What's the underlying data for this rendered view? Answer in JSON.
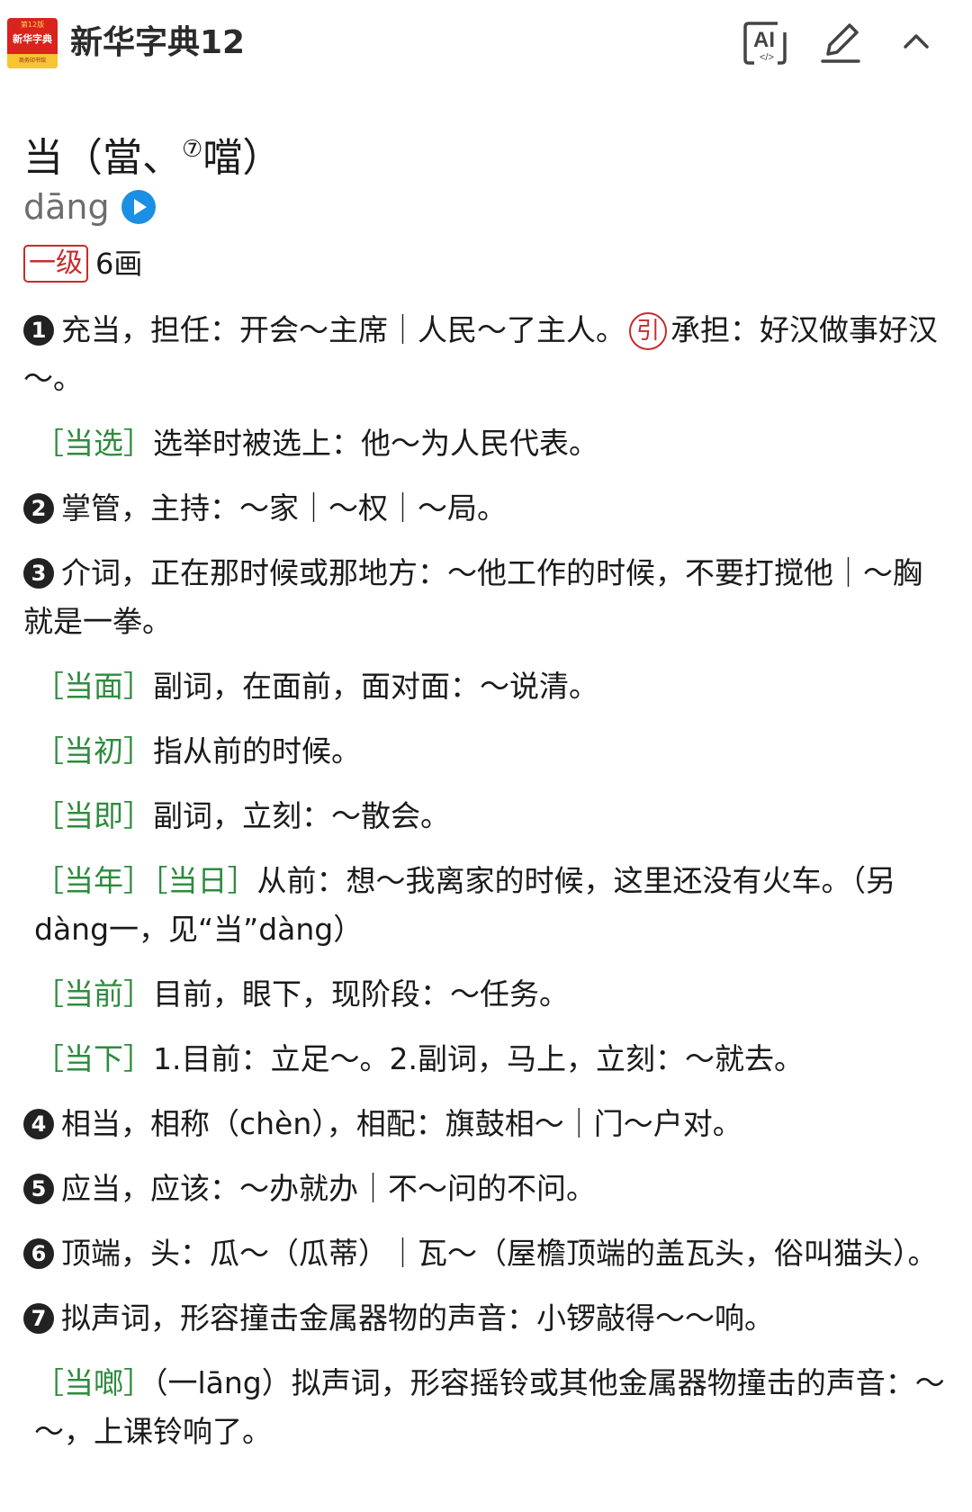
{
  "header": {
    "logo_top": "第12版",
    "logo_mid": "新华字典",
    "logo_bottom": "商务印书馆",
    "title": "新华字典12",
    "ai_label": "AI",
    "ai_sub": "</>"
  },
  "entry": {
    "headword": "当（當、",
    "variant_mark": "⑦",
    "variant_char": "噹）",
    "pinyin": "dāng",
    "level": "一级",
    "strokes": "6画"
  },
  "definitions": [
    {
      "num": "1",
      "text": "充当，担任：开会～主席｜人民～了主人。",
      "yin": "引",
      "extra": "承担：好汉做事好汉～。"
    },
    {
      "term": "［当选］",
      "text": "选举时被选上：他～为人民代表。"
    },
    {
      "num": "2",
      "text": "掌管，主持：～家｜～权｜～局。"
    },
    {
      "num": "3",
      "text": "介词，正在那时候或那地方：～他工作的时候，不要打搅他｜～胸就是一拳。"
    },
    {
      "term": "［当面］",
      "text": "副词，在面前，面对面：～说清。"
    },
    {
      "term": "［当初］",
      "text": "指从前的时候。"
    },
    {
      "term": "［当即］",
      "text": "副词，立刻：～散会。"
    },
    {
      "term": "［当年］",
      "term2": "［当日］",
      "text": "从前：想～我离家的时候，这里还没有火车。（另dàng一，见“当”dàng）"
    },
    {
      "term": "［当前］",
      "text": "目前，眼下，现阶段：～任务。"
    },
    {
      "term": "［当下］",
      "text": "1.目前：立足～。2.副词，马上，立刻：～就去。"
    },
    {
      "num": "4",
      "text": "相当，相称（chèn），相配：旗鼓相～｜门～户对。"
    },
    {
      "num": "5",
      "text": "应当，应该：～办就办｜不～问的不问。"
    },
    {
      "num": "6",
      "text": "顶端，头：瓜～（瓜蒂）｜瓦～（屋檐顶端的盖瓦头，俗叫猫头）。"
    },
    {
      "num": "7",
      "text": "拟声词，形容撞击金属器物的声音：小锣敲得～～响。"
    },
    {
      "term": "［当啷］",
      "text": "（一lāng）拟声词，形容摇铃或其他金属器物撞击的声音：～～，上课铃响了。"
    }
  ]
}
